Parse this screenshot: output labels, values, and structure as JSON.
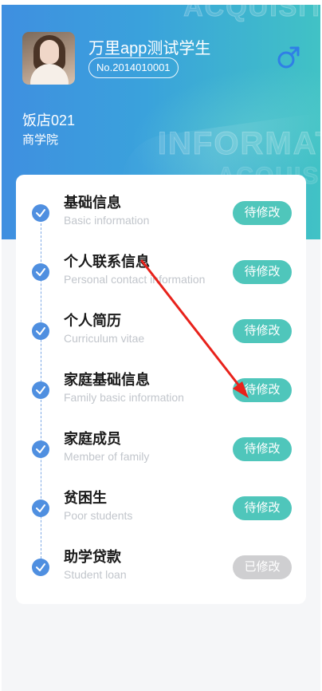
{
  "header": {
    "watermark_top": "ACQUISITI",
    "watermark_mid": "INFORMAT",
    "watermark_low": "ACQUISIT",
    "student_name": "万里app测试学生",
    "student_no": "No.2014010001",
    "gender_icon": "male-icon",
    "shop": "饭店021",
    "college": "商学院"
  },
  "colors": {
    "accent_blue": "#4f8fe0",
    "pending_teal": "#4fc6bb",
    "done_gray": "#cfcfd1",
    "annotation_red": "#e8221b"
  },
  "items": [
    {
      "title": "基础信息",
      "subtitle": "Basic information",
      "status": "待修改",
      "state": "pending"
    },
    {
      "title": "个人联系信息",
      "subtitle": "Personal contact information",
      "status": "待修改",
      "state": "pending"
    },
    {
      "title": "个人简历",
      "subtitle": "Curriculum vitae",
      "status": "待修改",
      "state": "pending"
    },
    {
      "title": "家庭基础信息",
      "subtitle": "Family basic information",
      "status": "待修改",
      "state": "pending"
    },
    {
      "title": "家庭成员",
      "subtitle": "Member of family",
      "status": "待修改",
      "state": "pending"
    },
    {
      "title": "贫困生",
      "subtitle": "Poor students",
      "status": "待修改",
      "state": "pending"
    },
    {
      "title": "助学贷款",
      "subtitle": "Student loan",
      "status": "已修改",
      "state": "done"
    }
  ]
}
